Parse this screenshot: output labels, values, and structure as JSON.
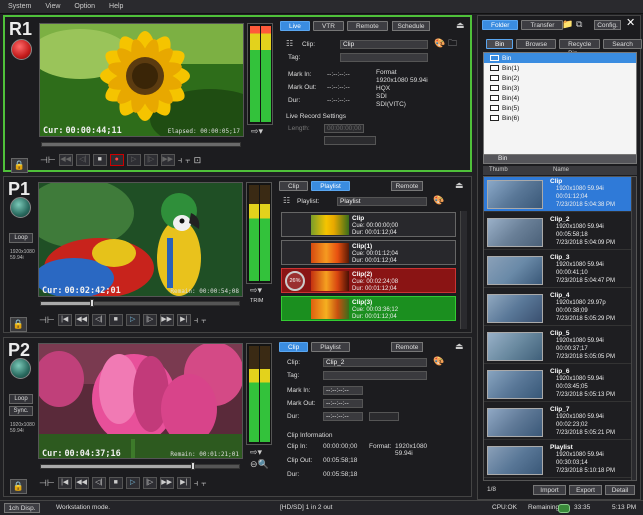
{
  "menu": [
    "System",
    "View",
    "Option",
    "Help"
  ],
  "r1": {
    "title": "R1",
    "tc_label": "Cur:",
    "tc": "00:00:44;11",
    "elapsed": "Elapsed: 00:00:05;17",
    "tabs": [
      "Live",
      "VTR",
      "Remote"
    ],
    "schedule": "Schedule",
    "clip_label": "Clip:",
    "clip_value": "Clip",
    "tag_label": "Tag:",
    "mark_in_label": "Mark In:",
    "mark_in": "--:--:--:--",
    "mark_out_label": "Mark Out:",
    "mark_out": "--:--:--:--",
    "dur_label": "Dur:",
    "dur": "--:--:--:--",
    "format_label": "Format",
    "format_lines": [
      "1920x1080 59.94i",
      "HQX",
      "SDI",
      "SDI(VITC)"
    ],
    "live_rec": "Live Record Settings",
    "length_label": "Length:",
    "length_value": "00:00:00;00"
  },
  "p1": {
    "title": "P1",
    "loop": "Loop",
    "fmt1": "1920x1080",
    "fmt2": "59.94i",
    "tc_label": "Cur:",
    "tc": "00:02:42;01",
    "remain": "Remain: 00:00:54;08",
    "trim": "TRIM",
    "scrub": 0.26,
    "tabs": [
      "Clip",
      "Playlist"
    ],
    "remote": "Remote",
    "playlist_label": "Playlist:",
    "playlist_value": "Playlist",
    "items": [
      {
        "name": "Clip",
        "cue": "Cue: 00:00:00;00",
        "dur": "Dur:  00:01:12;04",
        "state": "normal"
      },
      {
        "name": "Clip(1)",
        "cue": "Cue: 00:01:12;04",
        "dur": "Dur:  00:01:12;04",
        "state": "normal"
      },
      {
        "name": "Clip(2)",
        "cue": "Cue: 00:02:24;08",
        "dur": "Dur:  00:01:12;04",
        "state": "red",
        "pct": "26%"
      },
      {
        "name": "Clip(3)",
        "cue": "Cue: 00:03:36;12",
        "dur": "Dur:  00:01:12;04",
        "state": "green"
      }
    ]
  },
  "p2": {
    "title": "P2",
    "loop": "Loop",
    "sync": "Sync.",
    "fmt1": "1920x1080",
    "fmt2": "59.94i",
    "tc_label": "Cur:",
    "tc": "00:04:37;16",
    "remain": "Remain: 00:01:21;01",
    "scrub": 0.77,
    "tabs": [
      "Clip",
      "Playlist"
    ],
    "remote": "Remote",
    "clip_label": "Clip:",
    "clip_value": "Clip_2",
    "tag_label": "Tag:",
    "mark_in_label": "Mark In:",
    "mark_in": "--:--:--:--",
    "mark_out_label": "Mark Out:",
    "mark_out": "--:--:--:--",
    "dur_label": "Dur:",
    "dur": "--:--:--:--",
    "info_title": "Clip Information",
    "clip_in_label": "Clip In:",
    "clip_in": "00:00:00;00",
    "format_label": "Format:",
    "format_value1": "1920x1080",
    "format_value2": "59.94i",
    "clip_out_label": "Clip Out:",
    "clip_out": "00:05:58;18",
    "dur2_label": "Dur:",
    "dur2": "00:05:58;18"
  },
  "bin": {
    "tabs": [
      "Folder",
      "Transfer"
    ],
    "config": "Config.",
    "subtabs": [
      "Bin",
      "Browse",
      "Recycle Bin",
      "Search"
    ],
    "tree": [
      "Bin",
      "Bin(1)",
      "Bin(2)",
      "Bin(3)",
      "Bin(4)",
      "Bin(5)",
      "Bin(6)"
    ],
    "path": "Bin",
    "col_thumb": "Thumb",
    "col_name": "Name",
    "clips": [
      {
        "name": "Clip",
        "fmt": "1920x1080 59.94i",
        "dur": "00:01:12;04",
        "date": "7/23/2018 5:04:38 PM",
        "sel": true
      },
      {
        "name": "Clip_2",
        "fmt": "1920x1080 59.94i",
        "dur": "00:05:58;18",
        "date": "7/23/2018 5:04:09 PM"
      },
      {
        "name": "Clip_3",
        "fmt": "1920x1080 59.94i",
        "dur": "00:00:41;10",
        "date": "7/23/2018 5:04:47 PM"
      },
      {
        "name": "Clip_4",
        "fmt": "1920x1080 29.97p",
        "dur": "00:00:38;09",
        "date": "7/23/2018 5:05:29 PM"
      },
      {
        "name": "Clip_5",
        "fmt": "1920x1080 59.94i",
        "dur": "00:00:37;17",
        "date": "7/23/2018 5:05:05 PM"
      },
      {
        "name": "Clip_6",
        "fmt": "1920x1080 59.94i",
        "dur": "00:03:45;05",
        "date": "7/23/2018 5:05:13 PM"
      },
      {
        "name": "Clip_7",
        "fmt": "1920x1080 59.94i",
        "dur": "00:02:23;02",
        "date": "7/23/2018 5:05:21 PM"
      },
      {
        "name": "Playlist",
        "fmt": "1920x1080 59.94i",
        "dur": "00:30:03;14",
        "date": "7/23/2018 5:10:18 PM"
      }
    ],
    "page": "1/8",
    "import": "Import",
    "export": "Export",
    "detail": "Detail"
  },
  "status": {
    "disp": "1ch Disp.",
    "mode": "Workstation mode.",
    "route": "[HD/SD] 1 in 2 out",
    "cpu": "CPU:OK",
    "remaining_label": "Remaining",
    "remaining": "33:35",
    "time": "5:13 PM"
  }
}
